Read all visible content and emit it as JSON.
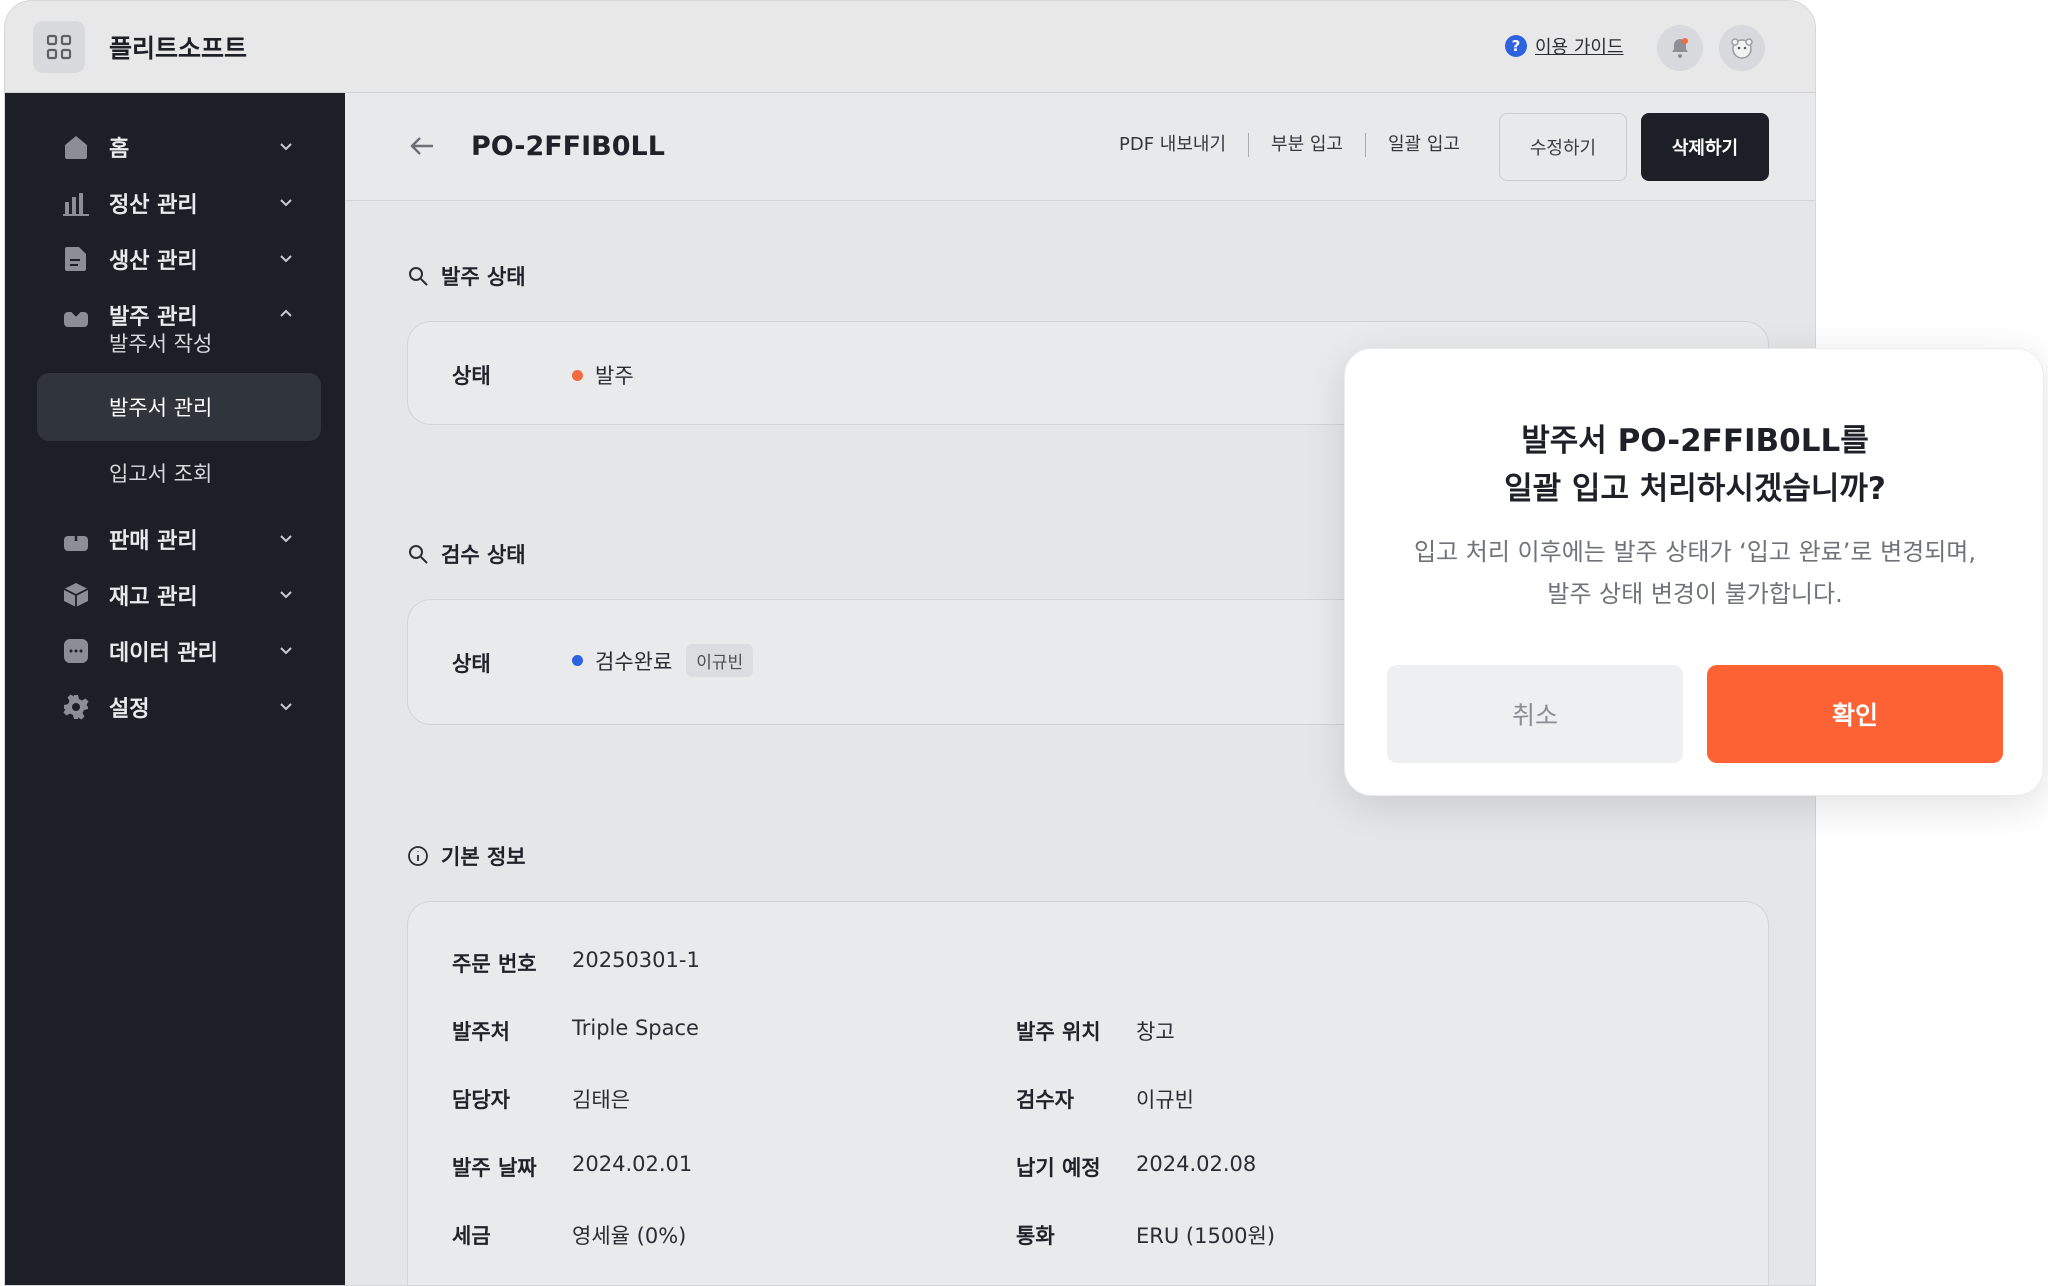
{
  "topbar": {
    "brand": "플리트소프트",
    "guide_label": "이용 가이드",
    "icons": {
      "menu": "grid-icon",
      "help": "question-icon",
      "notify": "bell-icon",
      "profile": "avatar-icon"
    }
  },
  "sidebar": {
    "items": [
      {
        "label": "홈",
        "icon": "home-icon",
        "expanded": false
      },
      {
        "label": "정산 관리",
        "icon": "bar-chart-icon",
        "expanded": false
      },
      {
        "label": "생산 관리",
        "icon": "document-icon",
        "expanded": false
      },
      {
        "label": "발주 관리",
        "icon": "inbox-icon",
        "expanded": true
      },
      {
        "label": "판매 관리",
        "icon": "outbox-icon",
        "expanded": false
      },
      {
        "label": "재고 관리",
        "icon": "box-icon",
        "expanded": false
      },
      {
        "label": "데이터 관리",
        "icon": "dots-icon",
        "expanded": false
      },
      {
        "label": "설정",
        "icon": "gear-icon",
        "expanded": false
      }
    ],
    "subitems": [
      {
        "label": "발주서 작성",
        "active": false
      },
      {
        "label": "발주서 관리",
        "active": true
      },
      {
        "label": "입고서 조회",
        "active": false
      }
    ]
  },
  "header": {
    "title": "PO-2FFIB0LL",
    "links": [
      "PDF 내보내기",
      "부분 입고",
      "일괄 입고"
    ],
    "edit_label": "수정하기",
    "delete_label": "삭제하기"
  },
  "order_status": {
    "title": "발주 상태",
    "key": "상태",
    "value": "발주",
    "dot_color": "#f26a3d"
  },
  "inspection_status": {
    "title": "검수 상태",
    "key": "상태",
    "value": "검수완료",
    "tag": "이규빈",
    "dot_color": "#2d62e0"
  },
  "basic_info": {
    "title": "기본 정보",
    "order_no_label": "주문 번호",
    "order_no": "20250301-1",
    "rows": [
      {
        "k1": "발주처",
        "v1": "Triple Space",
        "k2": "발주 위치",
        "v2": "창고"
      },
      {
        "k1": "담당자",
        "v1": "김태은",
        "k2": "검수자",
        "v2": "이규빈"
      },
      {
        "k1": "발주 날짜",
        "v1": "2024.02.01",
        "k2": "납기 예정",
        "v2": "2024.02.08"
      },
      {
        "k1": "세금",
        "v1": "영세율 (0%)",
        "k2": "통화",
        "v2": "ERU (1500원)"
      }
    ]
  },
  "modal": {
    "title_line1": "발주서 PO-2FFIB0LL를",
    "title_line2": "일괄 입고 처리하시겠습니까?",
    "desc_line1": "입고 처리 이후에는 발주 상태가 ‘입고 완료’로 변경되며,",
    "desc_line2": "발주 상태 변경이 불가합니다.",
    "cancel_label": "취소",
    "confirm_label": "확인",
    "confirm_color": "#fc6233"
  }
}
